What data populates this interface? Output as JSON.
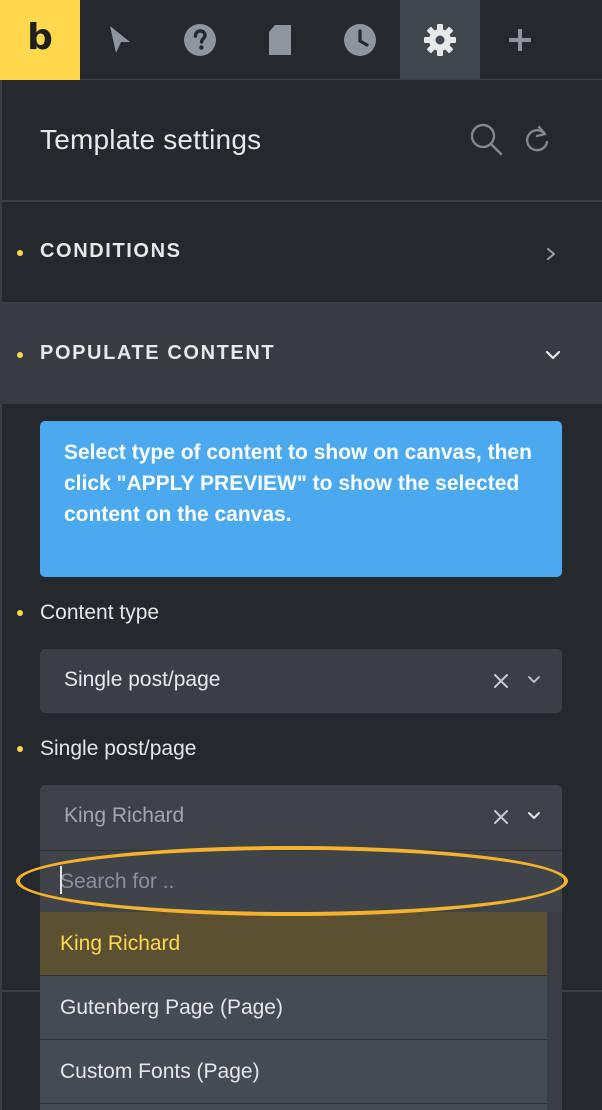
{
  "toolbar": {
    "logo_letter": "b",
    "buttons": [
      {
        "name": "elements",
        "icon": "cursor-icon"
      },
      {
        "name": "help",
        "icon": "help-icon"
      },
      {
        "name": "pages",
        "icon": "page-icon"
      },
      {
        "name": "history",
        "icon": "clock-icon"
      },
      {
        "name": "settings",
        "icon": "gear-icon",
        "active": true
      },
      {
        "name": "add",
        "icon": "plus-icon"
      }
    ]
  },
  "panel": {
    "title": "Template settings",
    "icons": [
      "search-icon",
      "refresh-icon"
    ]
  },
  "sections": {
    "conditions": {
      "label": "CONDITIONS",
      "icon": "chevron-right-icon"
    },
    "populate": {
      "label": "POPULATE CONTENT",
      "icon": "chevron-down-icon"
    }
  },
  "info": {
    "text": "Select type of content to show on canvas, then click \"APPLY PREVIEW\" to show the selected content on the canvas."
  },
  "fields": {
    "content_type": {
      "label": "Content type",
      "value": "Single post/page"
    },
    "single_post": {
      "label": "Single post/page",
      "value": "King Richard"
    }
  },
  "dropdown": {
    "search_placeholder": "Search for ..",
    "options": [
      "King Richard",
      "Gutenberg Page (Page)",
      "Custom Fonts (Page)"
    ],
    "selected": "King Richard"
  },
  "colors": {
    "accent": "#ffd84d",
    "info": "#4aa9ef",
    "highlight": "#f5b22a",
    "panel": "#25282c"
  }
}
